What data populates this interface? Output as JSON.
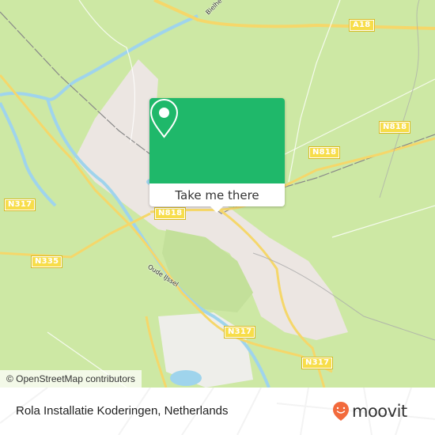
{
  "map": {
    "road_shields": {
      "a18": "A18",
      "n818_east": "N818",
      "n818_northeast": "N818",
      "n818_center": "N818",
      "n317_west": "N317",
      "n335": "N335",
      "n317_south": "N317",
      "n317_southeast": "N317"
    },
    "road_labels": {
      "bielheimerstraat": "Bielhe",
      "oude_ijssel": "Oude IJssel"
    },
    "colors": {
      "land": "#cde8a4",
      "urban": "#ece6e2",
      "water": "#9fd4ec",
      "road_major": "#f5d76a",
      "accent_green": "#1fb86a"
    }
  },
  "popup": {
    "icon": "location-pin-icon",
    "action_label": "Take me there"
  },
  "attribution": "© OpenStreetMap contributors",
  "footer": {
    "place_name": "Rola Installatie Koderingen, Netherlands",
    "brand": "moovit",
    "brand_color": "#f26a3c"
  }
}
